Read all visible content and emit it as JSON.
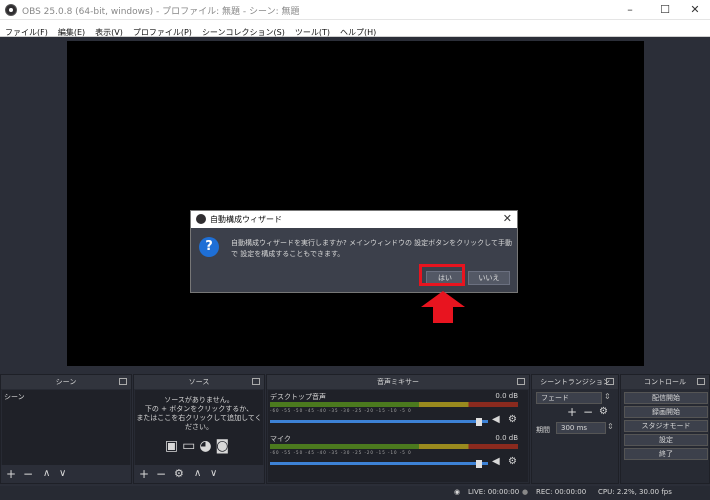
{
  "window": {
    "title": "OBS 25.0.8 (64-bit, windows) - プロファイル: 無題 - シーン: 無題",
    "minimize": "–",
    "maximize": "☐",
    "close": "✕"
  },
  "menu": [
    "ファイル(F)",
    "編集(E)",
    "表示(V)",
    "プロファイル(P)",
    "シーンコレクション(S)",
    "ツール(T)",
    "ヘルプ(H)"
  ],
  "dialog": {
    "title": "自動構成ウィザード",
    "icon": "?",
    "message": "自動構成ウィザードを実行しますか? メインウィンドウの 設定ボタンをクリックして手動で 設定を構成することもできます。",
    "yes": "はい",
    "no": "いいえ",
    "close": "✕"
  },
  "scenes": {
    "title": "シーン",
    "items": [
      "シーン"
    ],
    "footer": [
      "+",
      "−",
      "∧",
      "∨"
    ]
  },
  "sources": {
    "title": "ソース",
    "empty_message_1": "ソースがありません。",
    "empty_message_2": "下の + ボタンをクリックするか、",
    "empty_message_3": "またはここを右クリックして追加してください。",
    "footer": [
      "+",
      "−",
      "⚙",
      "∧",
      "∨"
    ]
  },
  "mixer": {
    "title": "音声ミキサー",
    "tracks": [
      {
        "name": "デスクトップ音声",
        "db": "0.0 dB"
      },
      {
        "name": "マイク",
        "db": "0.0 dB"
      }
    ],
    "ticks": "-60 -55 -50 -45 -40 -35 -30 -25 -20 -15 -10 -5 0"
  },
  "transitions": {
    "title": "シーントランジション",
    "selected": "フェード",
    "duration_label": "期間",
    "duration_value": "300 ms",
    "add": "+",
    "remove": "−",
    "gear": "⚙"
  },
  "controls": {
    "title": "コントロール",
    "buttons": [
      "配信開始",
      "録画開始",
      "スタジオモード",
      "設定",
      "終了"
    ]
  },
  "status": {
    "live": "LIVE: 00:00:00",
    "rec": "REC: 00:00:00",
    "cpu": "CPU: 2.2%, 30.00 fps"
  }
}
